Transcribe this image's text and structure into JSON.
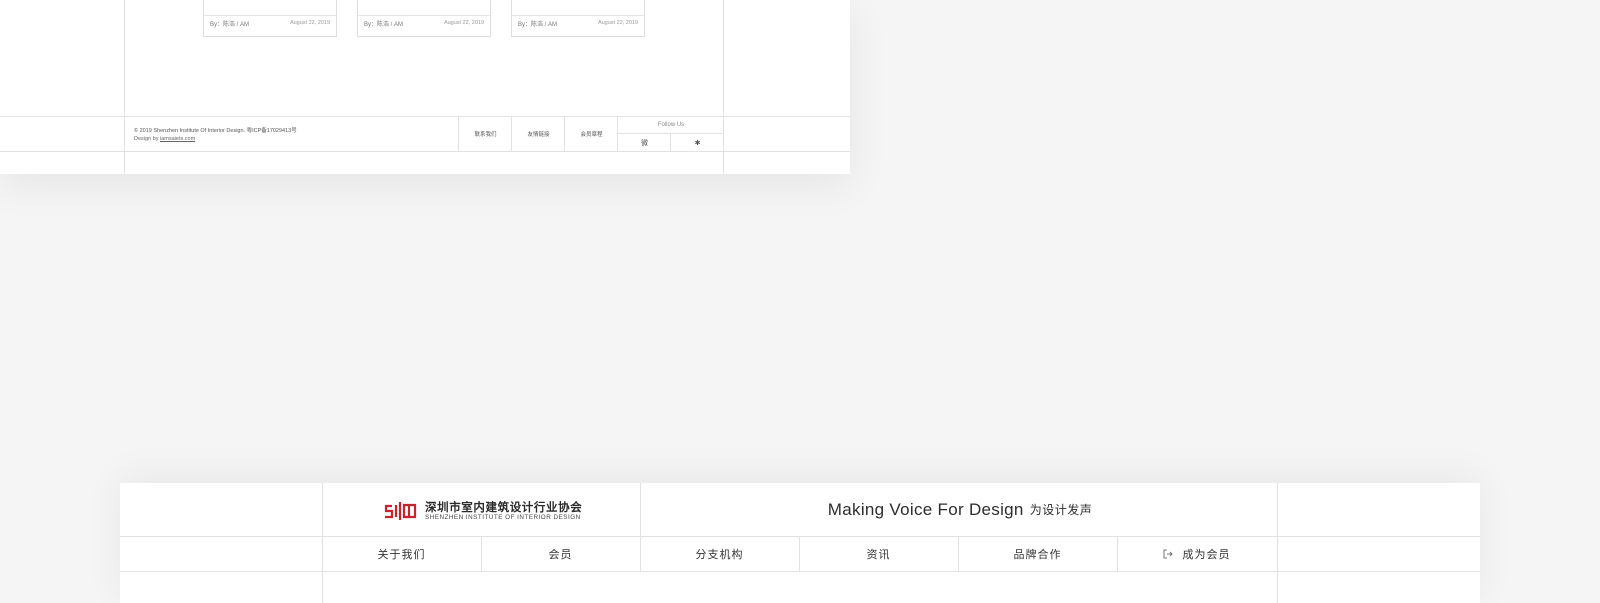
{
  "cards": [
    {
      "by": "By：陈浩 / AM",
      "date": "August 22, 2019"
    },
    {
      "by": "By：陈浩 / AM",
      "date": "August 22, 2019"
    },
    {
      "by": "By：陈浩 / AM",
      "date": "August 22, 2019"
    }
  ],
  "footer": {
    "copyright": "© 2019 Shenzhen Institute Of Interior Design.   粤ICP备17029413号",
    "design_by_prefix": "Design by ",
    "design_by_link": "iamsaiets.com",
    "links": [
      "联系我们",
      "友情链接",
      "会员章程"
    ],
    "follow_label": "Follow Us",
    "social": [
      {
        "icon": "weibo-icon",
        "glyph": "微"
      },
      {
        "icon": "wechat-icon",
        "glyph": "✱"
      }
    ]
  },
  "header": {
    "logo_cn": "深圳市室内建筑设计行业协会",
    "logo_en": "SHENZHEN INSTITUTE OF INTERIOR DESIGN",
    "tagline_en": "Making Voice For Design",
    "tagline_cn": "为设计发声",
    "brand_color": "#c8232c"
  },
  "nav": {
    "items": [
      "关于我们",
      "会员",
      "分支机构",
      "资讯",
      "品牌合作"
    ],
    "cta": {
      "icon": "login-icon",
      "label": "成为会员"
    }
  }
}
